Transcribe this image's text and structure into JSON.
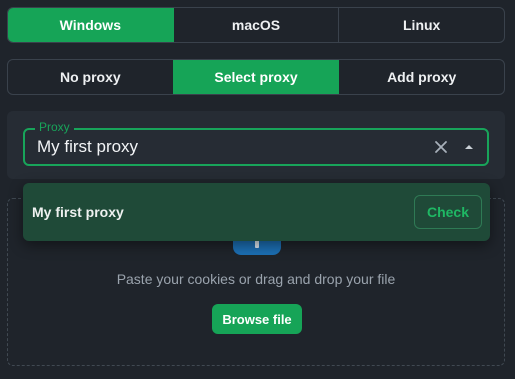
{
  "os_tabs": [
    {
      "label": "Windows",
      "active": true
    },
    {
      "label": "macOS",
      "active": false
    },
    {
      "label": "Linux",
      "active": false
    }
  ],
  "proxy_tabs": [
    {
      "label": "No proxy",
      "active": false
    },
    {
      "label": "Select proxy",
      "active": true
    },
    {
      "label": "Add proxy",
      "active": false
    }
  ],
  "proxy_select": {
    "legend": "Proxy",
    "value": "My first proxy",
    "clear_icon": "close-icon",
    "arrow_icon": "caret-down-icon"
  },
  "dropdown": {
    "option_label": "My first proxy",
    "check_label": "Check"
  },
  "dropzone": {
    "icon": "upload-icon",
    "hint": "Paste your cookies or drag and drop your file",
    "browse_label": "Browse file"
  },
  "colors": {
    "accent": "#16a457",
    "background": "#1f242b",
    "dropdown_bg": "#1f4a38",
    "upload_icon_bg": "#1c6fb4"
  }
}
